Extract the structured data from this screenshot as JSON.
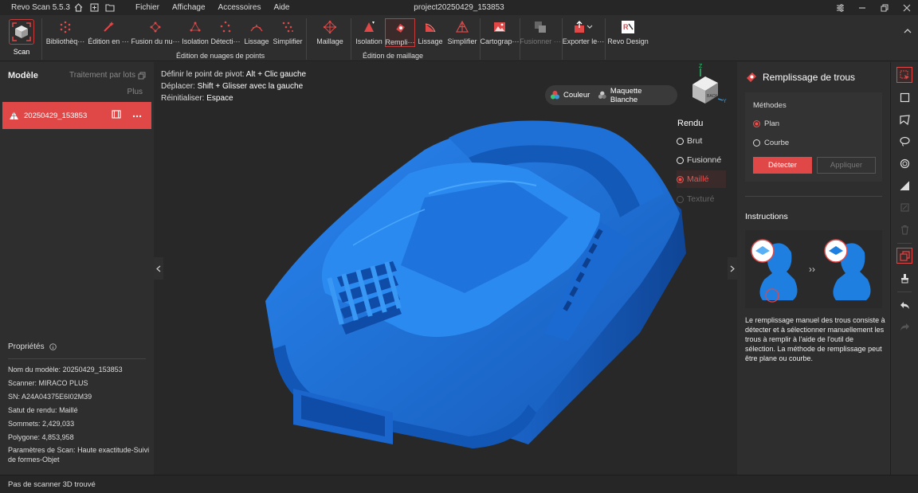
{
  "titlebar": {
    "app_name": "Revo Scan 5.5.3",
    "project": "project20250429_153853",
    "menu": [
      "Fichier",
      "Affichage",
      "Accessoires",
      "Aide"
    ]
  },
  "toolbar": {
    "scan_label": "Scan",
    "tools": [
      {
        "label": "Bibliothèq···"
      },
      {
        "label": "Édition en ···"
      },
      {
        "label": "Fusion du nu···"
      },
      {
        "label": "Isolation"
      },
      {
        "label": "Détecti···"
      },
      {
        "label": "Lissage"
      },
      {
        "label": "Simplifier"
      },
      {
        "label": "Maillage"
      },
      {
        "label": "Isolation"
      },
      {
        "label": "Rempli···"
      },
      {
        "label": "Lissage"
      },
      {
        "label": "Simplifier"
      },
      {
        "label": "Cartograp···"
      },
      {
        "label": "Fusionner ···"
      },
      {
        "label": "Exporter le···"
      },
      {
        "label": "Revo Design"
      }
    ],
    "group_point_cloud": "Édition de nuages de points",
    "group_mesh": "Édition de maillage"
  },
  "left_panel": {
    "title": "Modèle",
    "batch_label": "Traitement par lots",
    "more_label": "Plus",
    "model_name": "20250429_153853",
    "properties_title": "Propriétés",
    "properties": [
      {
        "key": "Nom du modèle:",
        "value": "20250429_153853"
      },
      {
        "key": "Scanner:",
        "value": "MIRACO PLUS"
      },
      {
        "key": "SN:",
        "value": "A24A04375E6I02M39"
      },
      {
        "key": "Satut de rendu:",
        "value": "Maillé"
      },
      {
        "key": "Sommets:",
        "value": "2,429,033"
      },
      {
        "key": "Polygone:",
        "value": "4,853,958"
      },
      {
        "key": "Paramètres de Scan:",
        "value": "Haute exactitude-Suivi de formes-Objet"
      }
    ]
  },
  "viewport": {
    "hints": [
      {
        "label": "Définir le point de pivot:",
        "keys": "Alt + Clic gauche"
      },
      {
        "label": "Déplacer:",
        "keys": "Shift + Glisser avec la gauche"
      },
      {
        "label": "Réinitialiser:",
        "keys": "Espace"
      }
    ],
    "render_toggle": {
      "color_label": "Couleur",
      "white_label": "Maquette Blanche"
    },
    "rendu_title": "Rendu",
    "rendu_options": [
      "Brut",
      "Fusionné",
      "Maillé",
      "Texturé"
    ],
    "rendu_selected": "Maillé",
    "axis_labels": {
      "z": "Z",
      "y": "Y",
      "cube_face": "BACK"
    }
  },
  "right_panel": {
    "title": "Remplissage de trous",
    "methods_label": "Méthodes",
    "options": [
      "Plan",
      "Courbe"
    ],
    "selected": "Plan",
    "detect_button": "Détecter",
    "apply_button": "Appliquer",
    "instructions_title": "Instructions",
    "description": "Le remplissage manuel des trous consiste à détecter et à sélectionner manuellement les trous à remplir à l'aide de l'outil de sélection. La méthode de remplissage peut être plane ou courbe."
  },
  "statusbar": {
    "text": "Pas de scanner 3D trouvé"
  },
  "colors": {
    "accent": "#e04848",
    "model_blue": "#1d6fd6"
  }
}
